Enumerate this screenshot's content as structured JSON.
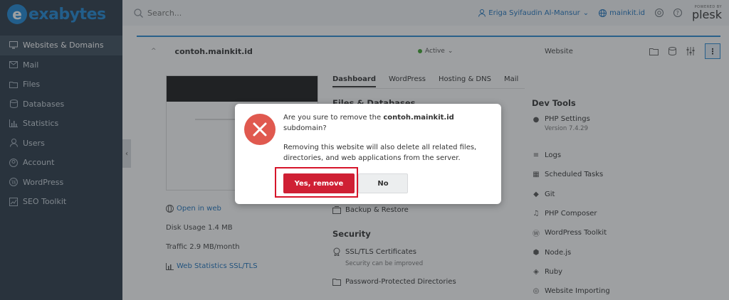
{
  "brand": {
    "logo_letter": "e",
    "logo_text": "exabytes",
    "accent": "#1e88d6"
  },
  "sidebar": {
    "items": [
      {
        "label": "Websites & Domains",
        "icon": "monitor-icon",
        "active": true
      },
      {
        "label": "Mail",
        "icon": "envelope-icon"
      },
      {
        "label": "Files",
        "icon": "folder-icon"
      },
      {
        "label": "Databases",
        "icon": "database-icon"
      },
      {
        "label": "Statistics",
        "icon": "bar-chart-icon"
      },
      {
        "label": "Users",
        "icon": "user-icon"
      },
      {
        "label": "Account",
        "icon": "account-icon"
      },
      {
        "label": "WordPress",
        "icon": "wordpress-icon"
      },
      {
        "label": "SEO Toolkit",
        "icon": "seo-icon"
      }
    ],
    "collapse_glyph": "‹"
  },
  "header": {
    "search_placeholder": "Search...",
    "user": "Eriga Syifaudin Al-Mansur",
    "user_chevron": "⌄",
    "domain": "mainkit.id",
    "plesk_small": "POWERED BY",
    "plesk_name": "plesk"
  },
  "domain_bar": {
    "chevron": "^",
    "name": "contoh.mainkit.id",
    "status": "Active",
    "status_chevron": "⌄",
    "status_color": "#3ea52e",
    "type": "Website",
    "more_glyph": "⋮"
  },
  "tabs": [
    "Dashboard",
    "WordPress",
    "Hosting & DNS",
    "Mail"
  ],
  "left_info": {
    "open_in_web": "Open in web",
    "disk_usage": "Disk Usage 1.4 MB",
    "traffic": "Traffic 2.9 MB/month",
    "web_stats": "Web Statistics SSL/TLS"
  },
  "middle": {
    "files_title": "Files & Databases",
    "backup": "Backup & Restore",
    "security_title": "Security",
    "ssl": "SSL/TLS Certificates",
    "ssl_sub": "Security can be improved",
    "password_dirs": "Password-Protected Directories"
  },
  "dev_tools": {
    "title": "Dev Tools",
    "php_settings": "PHP Settings",
    "php_version": "Version 7.4.29",
    "items": [
      "Logs",
      "Scheduled Tasks",
      "Git",
      "PHP Composer",
      "WordPress Toolkit",
      "Node.js",
      "Ruby",
      "Website Importing"
    ]
  },
  "dialog": {
    "line1_prefix": "Are you sure to remove the ",
    "line1_domain": "contoh.mainkit.id",
    "line1_suffix": "subdomain?",
    "line2": "Removing this website will also delete all related files, directories, and web applications from the server.",
    "yes_label": "Yes, remove",
    "no_label": "No",
    "icon": "close-circle-icon",
    "danger_color": "#cf2034"
  }
}
